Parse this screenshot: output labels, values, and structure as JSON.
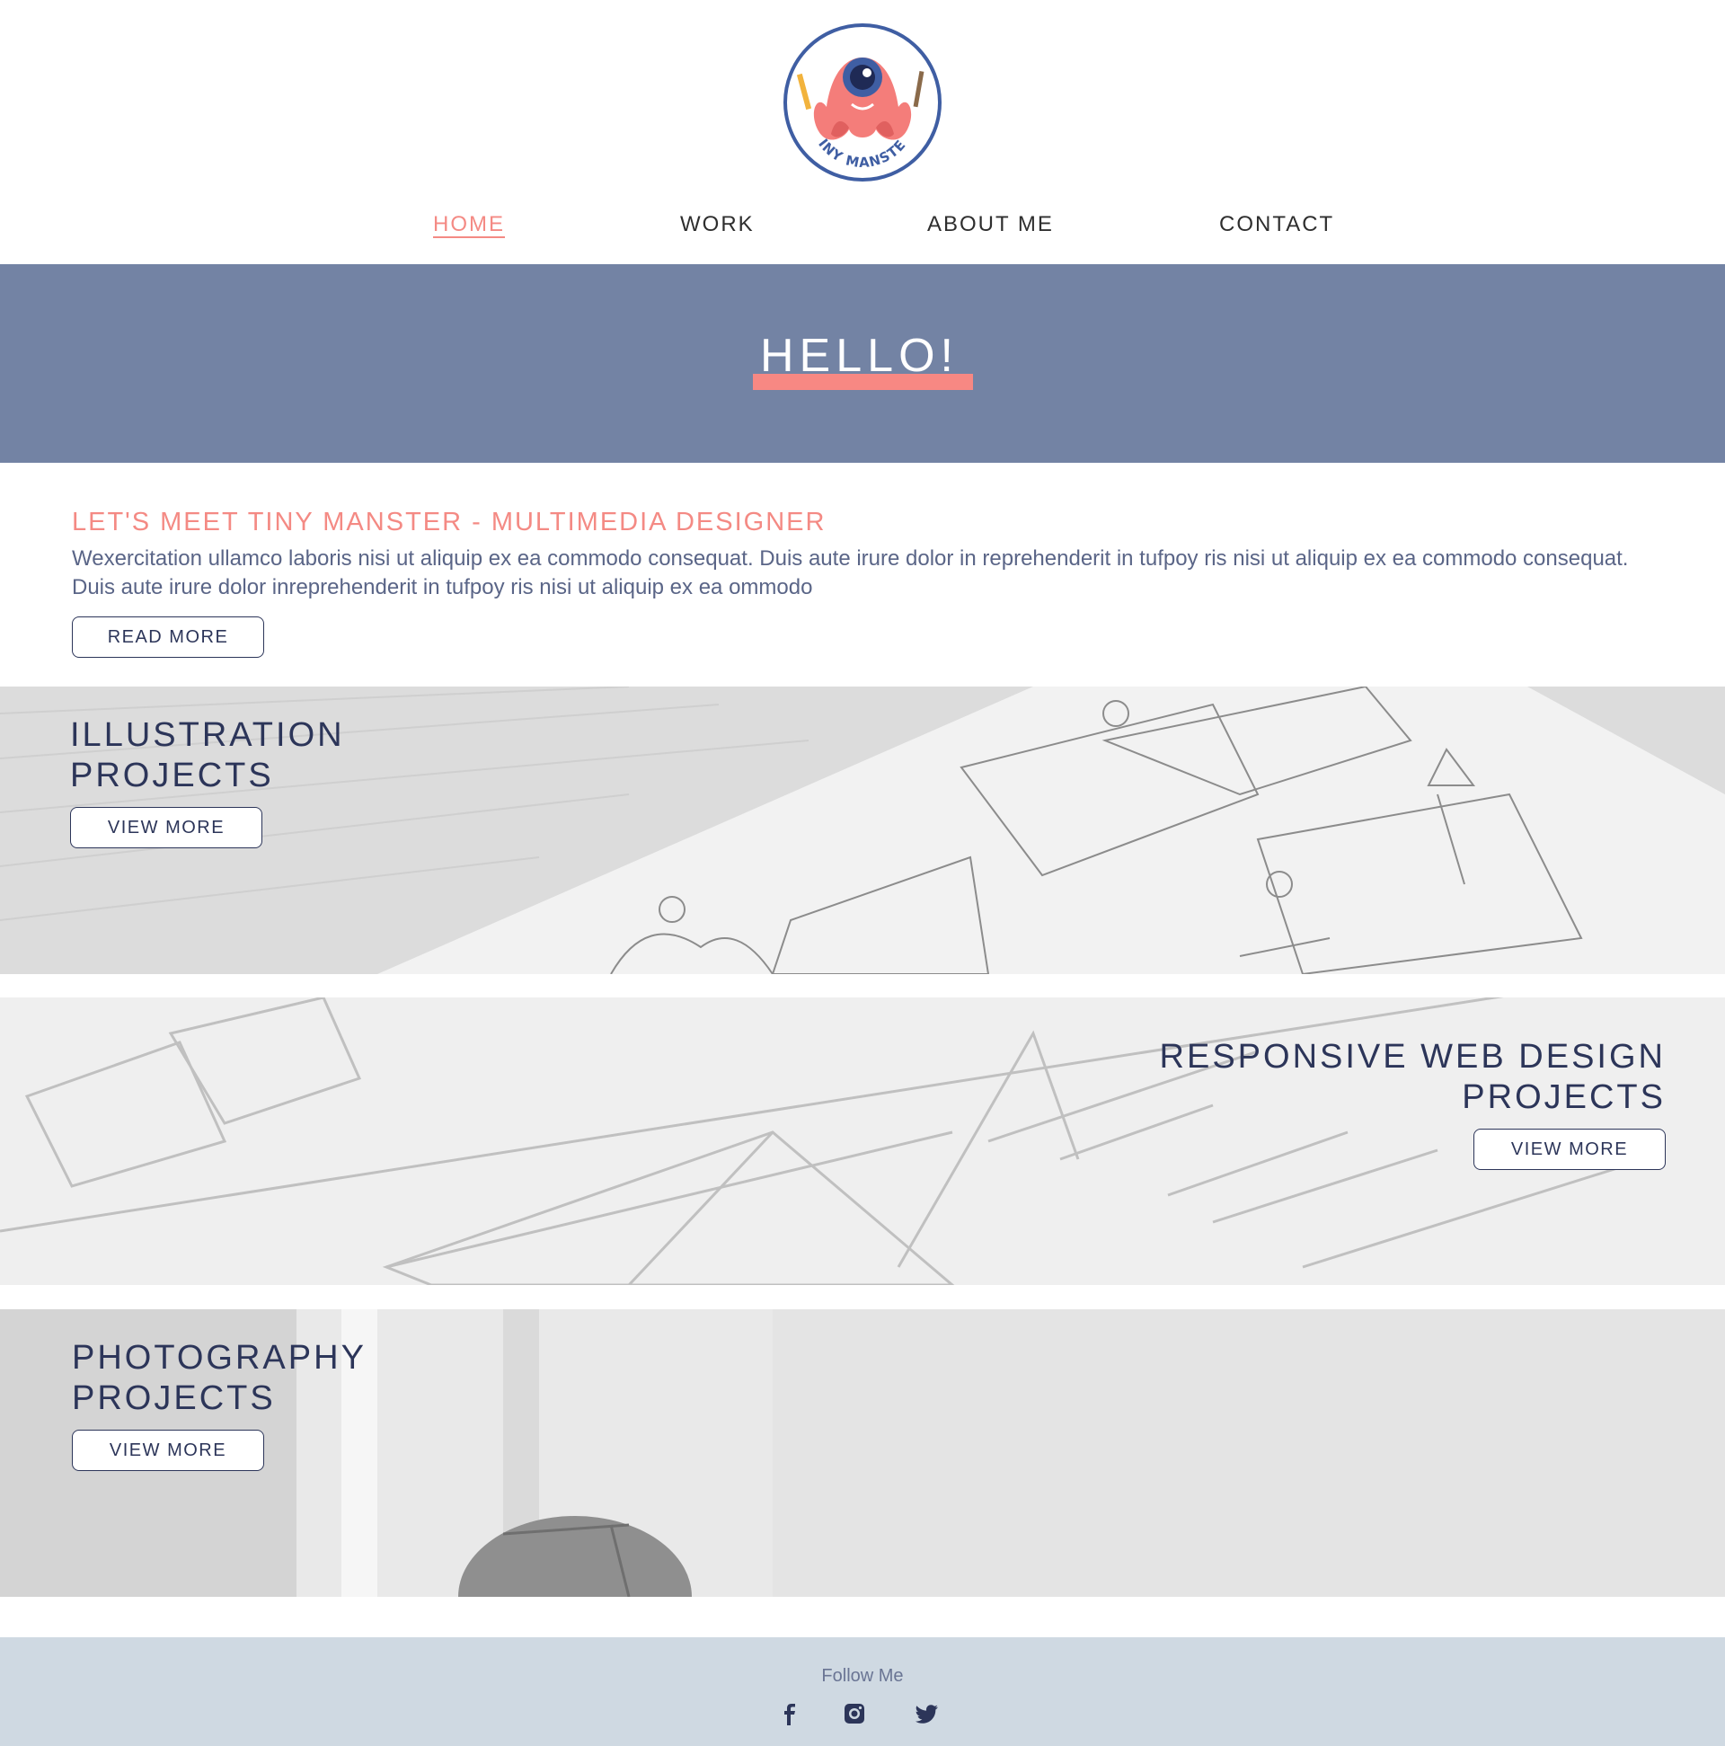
{
  "brand": {
    "logo_text": "TINY MANSTER",
    "colors": {
      "accent": "#f48a84",
      "navy": "#2c3559",
      "hero_bg": "#7383a4",
      "footer_bg": "#cfd9e2"
    }
  },
  "nav": {
    "items": [
      {
        "label": "HOME",
        "active": true
      },
      {
        "label": "WORK",
        "active": false
      },
      {
        "label": "ABOUT ME",
        "active": false
      },
      {
        "label": "CONTACT",
        "active": false
      }
    ]
  },
  "hero": {
    "title": "HELLO!"
  },
  "intro": {
    "heading": "LET'S MEET TINY MANSTER - MULTIMEDIA DESIGNER",
    "body": "Wexercitation ullamco laboris nisi ut aliquip ex ea commodo consequat. Duis  aute irure dolor in reprehenderit in tufpoy ris nisi ut aliquip ex ea commodo consequat. Duis aute irure dolor inreprehenderit in tufpoy ris nisi ut aliquip ex ea ommodo",
    "button_label": "READ MORE"
  },
  "projects": [
    {
      "title_line1": "ILLUSTRATION",
      "title_line2": "PROJECTS",
      "button_label": "VIEW MORE"
    },
    {
      "title_line1": "RESPONSIVE WEB DESIGN",
      "title_line2": "PROJECTS",
      "button_label": "VIEW MORE"
    },
    {
      "title_line1": "PHOTOGRAPHY",
      "title_line2": "PROJECTS",
      "button_label": "VIEW MORE"
    }
  ],
  "footer": {
    "follow_label": "Follow Me",
    "social": [
      "facebook-icon",
      "instagram-icon",
      "twitter-icon"
    ]
  }
}
